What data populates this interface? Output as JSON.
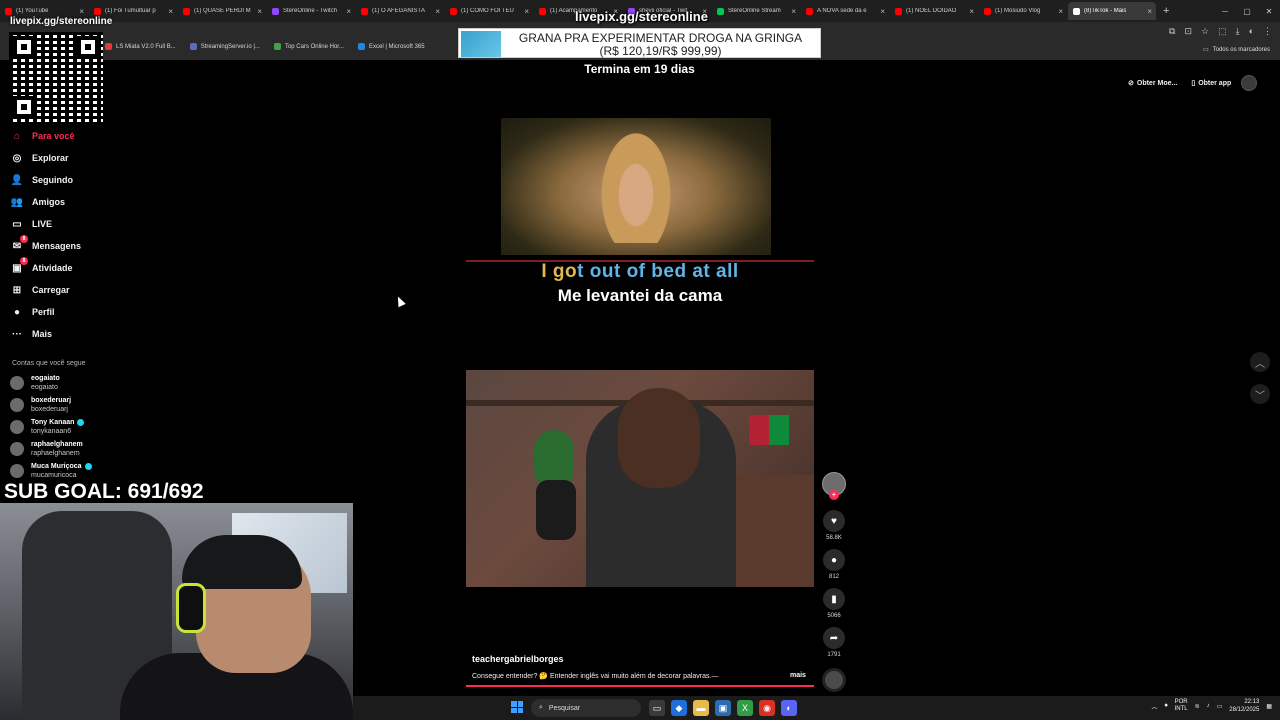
{
  "browser": {
    "tabs": [
      {
        "label": "(1) YouTube",
        "color": "#ff0000",
        "active": false
      },
      {
        "label": "(1) Foi Tumultuar p",
        "color": "#ff0000",
        "active": false
      },
      {
        "label": "(1) QUASE PERDI M",
        "color": "#ff0000",
        "active": false
      },
      {
        "label": "StereOnline - Twitch",
        "color": "#9146ff",
        "active": false
      },
      {
        "label": "(1) O AFEGANISTÃ",
        "color": "#ff0000",
        "active": false
      },
      {
        "label": "(1) COMO FOI TEU",
        "color": "#ff0000",
        "active": false
      },
      {
        "label": "(1) Acampamento",
        "color": "#ff0000",
        "active": false
      },
      {
        "label": "shevii oficial - Twit",
        "color": "#9146ff",
        "active": false
      },
      {
        "label": "StereOnline Stream",
        "color": "#00c853",
        "active": false
      },
      {
        "label": "A NOVA sede da e",
        "color": "#ff0000",
        "active": false
      },
      {
        "label": "(1) NOEL DOIDÃO",
        "color": "#ff0000",
        "active": false
      },
      {
        "label": "(1) Mosiúdo Vlog",
        "color": "#ff0000",
        "active": false
      },
      {
        "label": "(8)TikTok - Mais",
        "color": "#ffffff",
        "active": true
      }
    ],
    "bookmarks": [
      {
        "label": "LS Miata V2.0 Full B...",
        "color": "#e53935"
      },
      {
        "label": "StreamingServer.io |...",
        "color": "#5c6bc0"
      },
      {
        "label": "Top Cars Online Hor...",
        "color": "#43a047"
      },
      {
        "label": "Excel | Microsoft 365",
        "color": "#1e88e5"
      }
    ],
    "bookmarks_all_label": "Todos os marcadores"
  },
  "overlay": {
    "url": "livepix.gg/stereonline",
    "qr_label": "livepix.gg/stereonline",
    "promo_title": "GRANA PRA EXPERIMENTAR DROGA NA GRINGA",
    "promo_progress": "(R$ 120,19/R$ 999,99)",
    "promo_ends": "Termina em 19 dias",
    "sub_goal": "SUB GOAL: 691/692"
  },
  "sidebar": {
    "items": [
      {
        "label": "Para você",
        "icon": "home-icon",
        "glyph": "⌂",
        "active": true
      },
      {
        "label": "Explorar",
        "icon": "compass-icon",
        "glyph": "◎",
        "active": false
      },
      {
        "label": "Seguindo",
        "icon": "user-follow-icon",
        "glyph": "👤",
        "active": false
      },
      {
        "label": "Amigos",
        "icon": "friends-icon",
        "glyph": "👥",
        "active": false
      },
      {
        "label": "LIVE",
        "icon": "live-icon",
        "glyph": "▭",
        "active": false
      },
      {
        "label": "Mensagens",
        "icon": "messages-icon",
        "glyph": "✉",
        "active": false,
        "badge": "8"
      },
      {
        "label": "Atividade",
        "icon": "activity-icon",
        "glyph": "▣",
        "active": false,
        "badge": "8"
      },
      {
        "label": "Carregar",
        "icon": "upload-icon",
        "glyph": "⊞",
        "active": false
      },
      {
        "label": "Perfil",
        "icon": "profile-icon",
        "glyph": "●",
        "active": false
      },
      {
        "label": "Mais",
        "icon": "more-icon",
        "glyph": "···",
        "active": false
      }
    ],
    "following_header": "Contas que você segue",
    "accounts": [
      {
        "name": "eogaiato",
        "handle": "eogaiato",
        "verified": false
      },
      {
        "name": "boxederuarj",
        "handle": "boxederuarj",
        "verified": false
      },
      {
        "name": "Tony Kanaan",
        "handle": "tonykanaan6",
        "verified": true
      },
      {
        "name": "raphaelghanem",
        "handle": "raphaelghanem",
        "verified": false
      },
      {
        "name": "Muca Muriçoca",
        "handle": "mucamuricoca",
        "verified": true
      }
    ]
  },
  "topbar": {
    "coins_label": "Obter Moe...",
    "app_label": "Obter app"
  },
  "video1": {
    "subtitle_en_prefix": "I go",
    "subtitle_en_rest": "t out of bed at all",
    "subtitle_pt": "Me levantei da cama"
  },
  "video2": {
    "author": "teachergabrielborges",
    "caption": "Consegue entender? 🤔 Entender inglês vai muito além de decorar palavras.—",
    "more_label": "mais",
    "likes": "58.8K",
    "comments": "812",
    "saves": "5066",
    "shares": "1791"
  },
  "taskbar": {
    "search_placeholder": "Pesquisar",
    "lang_top": "POR",
    "lang_bottom": "INTL",
    "time": "22:13",
    "date": "28/12/2025"
  }
}
